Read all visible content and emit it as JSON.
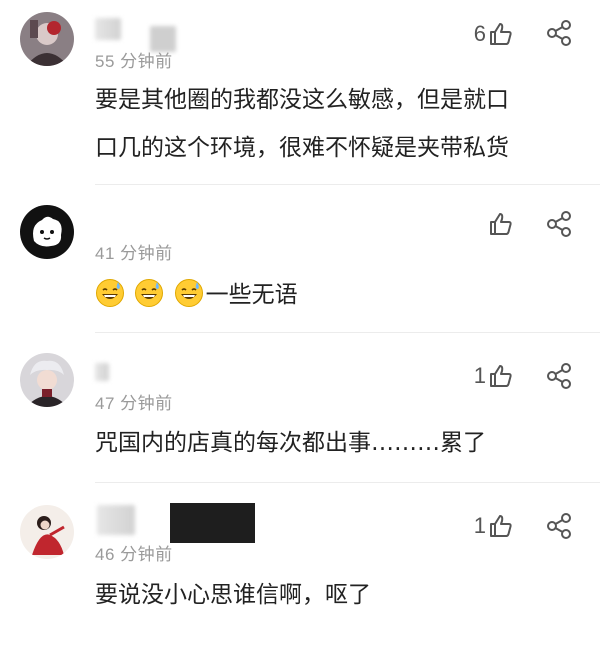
{
  "comments": [
    {
      "time": "55 分钟前",
      "likes": "6",
      "text_lines": [
        "要是其他圈的我都没这么敏感，但是就口",
        "口几的这个环境，很难不怀疑是夹带私货"
      ]
    },
    {
      "time": "41 分钟前",
      "likes": "",
      "emoji": [
        "grinning-sweat",
        "grinning-sweat",
        "grinning-sweat"
      ],
      "text": "一些无语"
    },
    {
      "time": "47 分钟前",
      "likes": "1",
      "text": "咒国内的店真的每次都出事………累了"
    },
    {
      "time": "46 分钟前",
      "likes": "1",
      "text": "要说没小心思谁信啊，呕了"
    }
  ],
  "icons": {
    "like": "thumbs-up-icon",
    "share": "share-icon"
  },
  "colors": {
    "text": "#222222",
    "meta": "#9a9a9a",
    "icon": "#555555"
  }
}
